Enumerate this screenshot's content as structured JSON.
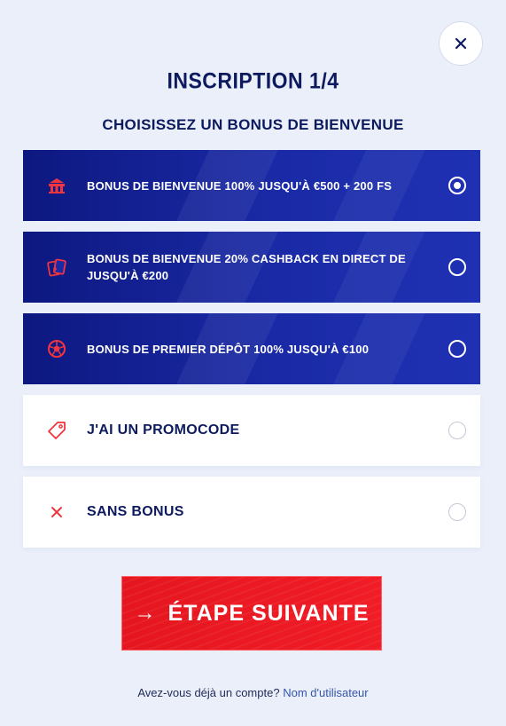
{
  "header": {
    "title": "INSCRIPTION 1/4",
    "subtitle": "CHOISISSEZ UN BONUS DE BIENVENUE"
  },
  "options": [
    {
      "label": "BONUS DE BIENVENUE 100% JUSQU'À €500 + 200 FS",
      "icon": "casino-icon",
      "selected": true
    },
    {
      "label": "BONUS DE BIENVENUE 20% CASHBACK EN DIRECT DE JUSQU'À €200",
      "icon": "cards-icon",
      "selected": false
    },
    {
      "label": "BONUS DE PREMIER DÉPÔT 100% JUSQU'À €100",
      "icon": "soccer-ball-icon",
      "selected": false
    },
    {
      "label": "J'AI UN PROMOCODE",
      "icon": "tag-icon",
      "selected": false
    },
    {
      "label": "SANS BONUS",
      "icon": "x-icon",
      "selected": false
    }
  ],
  "next_button": {
    "label": "ÉTAPE SUIVANTE",
    "arrow": "→"
  },
  "footer": {
    "question": "Avez-vous déjà un compte?",
    "link": "Nom d'utilisateur"
  },
  "colors": {
    "accent_red": "#f01c26",
    "navy": "#0d1b5e",
    "option_blue": "#1a2aa6",
    "background": "#eaeffa"
  }
}
